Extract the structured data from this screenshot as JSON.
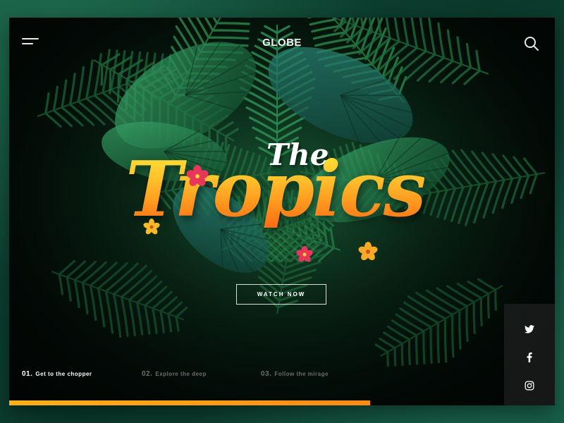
{
  "header": {
    "brand": "GLOBE",
    "menu_icon": "hamburger-menu-icon",
    "search_icon": "search-icon"
  },
  "hero": {
    "title_small": "The",
    "title_main": "Tropics",
    "cta_label": "WATCH NOW"
  },
  "steps": [
    {
      "num": "01.",
      "label": "Get to the chopper",
      "active": true
    },
    {
      "num": "02.",
      "label": "Explore the deep",
      "active": false
    },
    {
      "num": "03.",
      "label": "Follow the mirage",
      "active": false
    }
  ],
  "progress": {
    "value": 0.73
  },
  "social": [
    {
      "icon": "twitter-icon"
    },
    {
      "icon": "facebook-icon"
    },
    {
      "icon": "instagram-icon"
    }
  ],
  "colors": {
    "accent_start": "#ffb01a",
    "accent_end": "#ff6a14",
    "title_top": "#ffe43a",
    "foliage": "#1c6b3c",
    "frame_bg": "#020805"
  }
}
